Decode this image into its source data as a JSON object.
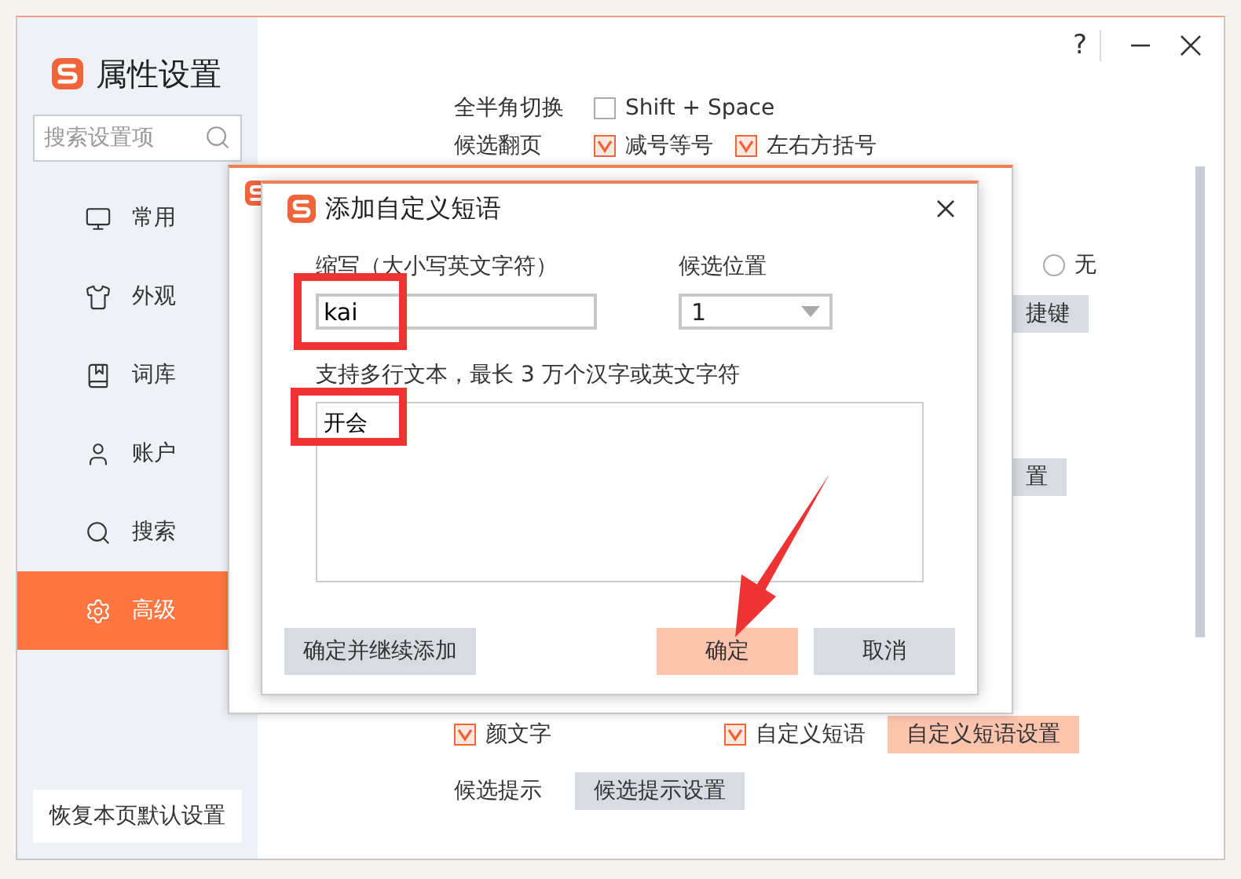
{
  "window": {
    "title": "属性设置",
    "help": "?"
  },
  "sidebar": {
    "search": {
      "placeholder": "搜索设置项"
    },
    "items": [
      {
        "label": "常用",
        "selected": false
      },
      {
        "label": "外观",
        "selected": false
      },
      {
        "label": "词库",
        "selected": false
      },
      {
        "label": "账户",
        "selected": false
      },
      {
        "label": "搜索",
        "selected": false
      },
      {
        "label": "高级",
        "selected": true
      }
    ],
    "reset_button": "恢复本页默认设置"
  },
  "content": {
    "rows": [
      {
        "label": "全半角切换",
        "options": [
          {
            "label": "Shift + Space",
            "checked": false
          }
        ]
      },
      {
        "label": "候选翻页",
        "options": [
          {
            "label": "减号等号",
            "checked": true
          },
          {
            "label": "左右方括号",
            "checked": true
          }
        ]
      }
    ],
    "radio": {
      "label": "无",
      "selected": false
    },
    "partial_buttons": [
      "捷键",
      "置"
    ],
    "bottom_rows": [
      {
        "options": [
          {
            "label": "颜文字",
            "checked": true
          },
          {
            "label": "自定义短语",
            "checked": true
          }
        ],
        "button": {
          "label": "自定义短语设置",
          "primary": true
        }
      },
      {
        "label": "候选提示",
        "button": {
          "label": "候选提示设置",
          "primary": false
        }
      }
    ]
  },
  "dialog": {
    "title": "添加自定义短语",
    "abbr_label": "缩写（大小写英文字符）",
    "abbr_value": "kai",
    "position_label": "候选位置",
    "position_value": "1",
    "text_label": "支持多行文本，最长 3 万个汉字或英文字符",
    "text_value": "开会",
    "buttons": [
      {
        "label": "确定并继续添加",
        "kind": "secondary"
      },
      {
        "label": "确定",
        "kind": "primary"
      },
      {
        "label": "取消",
        "kind": "secondary"
      }
    ]
  }
}
